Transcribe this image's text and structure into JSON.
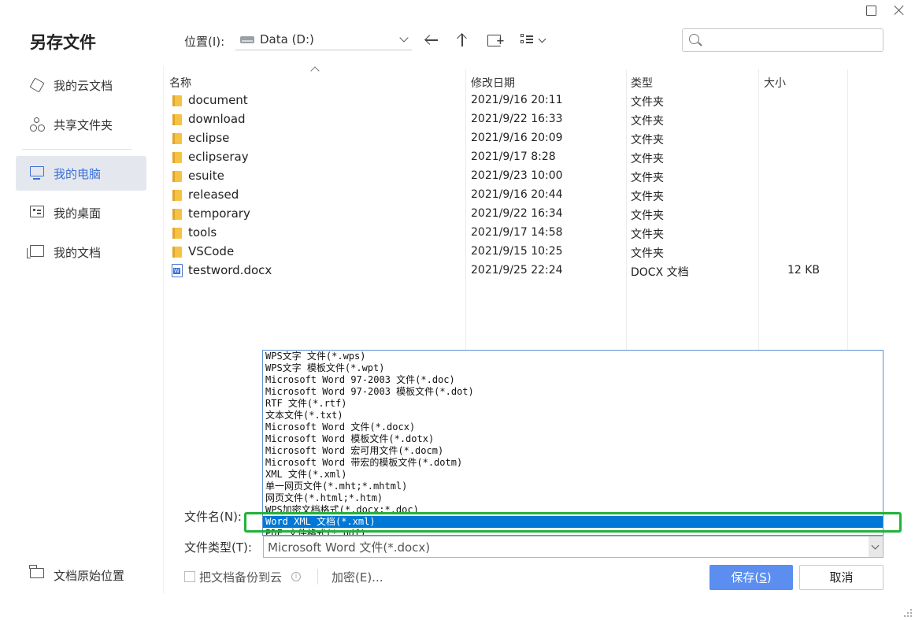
{
  "window": {
    "title": "另存文件",
    "maximize_icon": "maximize-icon",
    "close_icon": "close-icon"
  },
  "toolbar": {
    "location_label": "位置(I):",
    "path": "Data (D:)",
    "back_icon": "back-arrow-icon",
    "up_icon": "up-arrow-icon",
    "new_folder_icon": "new-folder-icon",
    "view_icon": "view-mode-icon",
    "search_placeholder": "",
    "search_icon": "search-icon"
  },
  "sidebar": {
    "items": [
      {
        "label": "我的云文档",
        "icon": "cloud-docs-icon",
        "active": false
      },
      {
        "label": "共享文件夹",
        "icon": "shared-folder-icon",
        "active": false
      },
      {
        "label": "我的电脑",
        "icon": "computer-icon",
        "active": true
      },
      {
        "label": "我的桌面",
        "icon": "desktop-icon",
        "active": false
      },
      {
        "label": "我的文档",
        "icon": "documents-icon",
        "active": false
      }
    ],
    "bottom_label": "文档原始位置",
    "bottom_icon": "original-location-icon"
  },
  "file_list": {
    "columns": [
      "名称",
      "修改日期",
      "类型",
      "大小"
    ],
    "rows": [
      {
        "name": "document",
        "date": "2021/9/16 20:11",
        "type": "文件夹",
        "size": "",
        "icon": "folder-icon"
      },
      {
        "name": "download",
        "date": "2021/9/22 16:33",
        "type": "文件夹",
        "size": "",
        "icon": "folder-icon"
      },
      {
        "name": "eclipse",
        "date": "2021/9/16 20:09",
        "type": "文件夹",
        "size": "",
        "icon": "folder-icon"
      },
      {
        "name": "eclipseray",
        "date": "2021/9/17 8:28",
        "type": "文件夹",
        "size": "",
        "icon": "folder-icon"
      },
      {
        "name": "esuite",
        "date": "2021/9/23 10:00",
        "type": "文件夹",
        "size": "",
        "icon": "folder-icon"
      },
      {
        "name": "released",
        "date": "2021/9/16 20:44",
        "type": "文件夹",
        "size": "",
        "icon": "folder-icon"
      },
      {
        "name": "temporary",
        "date": "2021/9/22 16:34",
        "type": "文件夹",
        "size": "",
        "icon": "folder-icon"
      },
      {
        "name": "tools",
        "date": "2021/9/17 14:58",
        "type": "文件夹",
        "size": "",
        "icon": "folder-icon"
      },
      {
        "name": "VSCode",
        "date": "2021/9/15 10:25",
        "type": "文件夹",
        "size": "",
        "icon": "folder-icon"
      },
      {
        "name": "testword.docx",
        "date": "2021/9/25 22:24",
        "type": "DOCX 文档",
        "size": "12 KB",
        "icon": "word-doc-icon"
      }
    ]
  },
  "form": {
    "filename_label": "文件名(N):",
    "filetype_label": "文件类型(T):",
    "filetype_value": "Microsoft Word 文件(*.docx)",
    "filetype_options": [
      "WPS文字 文件(*.wps)",
      "WPS文字 模板文件(*.wpt)",
      "Microsoft Word 97-2003 文件(*.doc)",
      "Microsoft Word 97-2003 模板文件(*.dot)",
      "RTF 文件(*.rtf)",
      "文本文件(*.txt)",
      "Microsoft Word 文件(*.docx)",
      "Microsoft Word 模板文件(*.dotx)",
      "Microsoft Word 宏可用文件(*.docm)",
      "Microsoft Word 带宏的模板文件(*.dotm)",
      "XML 文件(*.xml)",
      "单一网页文件(*.mht;*.mhtml)",
      "网页文件(*.html;*.htm)",
      "WPS加密文档格式(*.docx;*.doc)",
      "Word XML 文档(*.xml)",
      "PDF 文件格式(*.pdf)"
    ],
    "selected_option": "Word XML 文档(*.xml)"
  },
  "footer": {
    "backup_label": "把文档备份到云",
    "encrypt_label": "加密(E)...",
    "save_label_main": "保存(",
    "save_label_key": "S",
    "save_label_end": ")",
    "cancel_label": "取消"
  },
  "colors": {
    "accent": "#5b8ef0",
    "selection": "#0078d7",
    "highlight_box": "#22b33a",
    "active_sidebar_bg": "#e4e8ee"
  }
}
